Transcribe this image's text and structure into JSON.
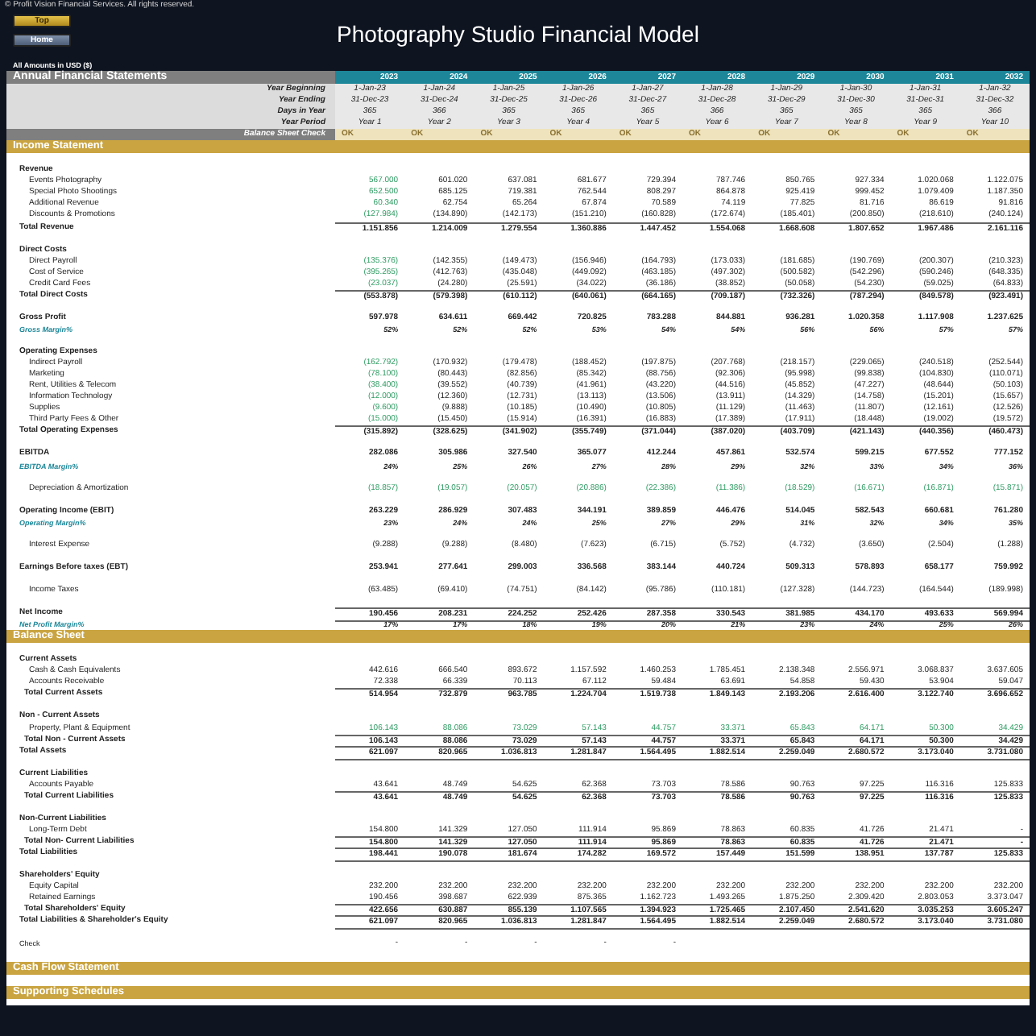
{
  "copyright": "© Profit Vision Financial Services. All rights reserved.",
  "buttons": [
    {
      "label": "Top",
      "kind": "gold"
    },
    {
      "label": "Home",
      "kind": "slate"
    }
  ],
  "title": "Photography Studio Financial Model",
  "units_note": "All Amounts in  USD ($)",
  "header": {
    "title": "Annual Financial Statements",
    "years": [
      "2023",
      "2024",
      "2025",
      "2026",
      "2027",
      "2028",
      "2029",
      "2030",
      "2031",
      "2032"
    ],
    "rows": [
      {
        "label": "Year Beginning",
        "values": [
          "1-Jan-23",
          "1-Jan-24",
          "1-Jan-25",
          "1-Jan-26",
          "1-Jan-27",
          "1-Jan-28",
          "1-Jan-29",
          "1-Jan-30",
          "1-Jan-31",
          "1-Jan-32"
        ]
      },
      {
        "label": "Year Ending",
        "values": [
          "31-Dec-23",
          "31-Dec-24",
          "31-Dec-25",
          "31-Dec-26",
          "31-Dec-27",
          "31-Dec-28",
          "31-Dec-29",
          "31-Dec-30",
          "31-Dec-31",
          "31-Dec-32"
        ]
      },
      {
        "label": "Days in Year",
        "values": [
          "365",
          "366",
          "365",
          "365",
          "365",
          "366",
          "365",
          "365",
          "365",
          "366"
        ]
      },
      {
        "label": "Year Period",
        "values": [
          "Year 1",
          "Year 2",
          "Year 3",
          "Year 4",
          "Year 5",
          "Year 6",
          "Year 7",
          "Year 8",
          "Year 9",
          "Year 10"
        ]
      }
    ],
    "check": {
      "label": "Balance Sheet Check",
      "values": [
        "OK",
        "OK",
        "OK",
        "OK",
        "OK",
        "OK",
        "OK",
        "OK",
        "OK",
        "OK"
      ]
    }
  },
  "sections": [
    {
      "title": "Income Statement",
      "rows": [
        {
          "label": "Revenue",
          "kind": "heading",
          "space_before": true,
          "values": []
        },
        {
          "label": "Events Photography",
          "kind": "item",
          "first_input": true,
          "values": [
            "567.000",
            "601.020",
            "637.081",
            "681.677",
            "729.394",
            "787.746",
            "850.765",
            "927.334",
            "1.020.068",
            "1.122.075"
          ]
        },
        {
          "label": "Special Photo Shootings",
          "kind": "item",
          "first_input": true,
          "values": [
            "652.500",
            "685.125",
            "719.381",
            "762.544",
            "808.297",
            "864.878",
            "925.419",
            "999.452",
            "1.079.409",
            "1.187.350"
          ]
        },
        {
          "label": "Additional Revenue",
          "kind": "item",
          "first_input": true,
          "values": [
            "60.340",
            "62.754",
            "65.264",
            "67.874",
            "70.589",
            "74.119",
            "77.825",
            "81.716",
            "86.619",
            "91.816"
          ]
        },
        {
          "label": "Discounts & Promotions",
          "kind": "item",
          "first_input": true,
          "values": [
            "(127.984)",
            "(134.890)",
            "(142.173)",
            "(151.210)",
            "(160.828)",
            "(172.674)",
            "(185.401)",
            "(200.850)",
            "(218.610)",
            "(240.124)"
          ]
        },
        {
          "label": "Total Revenue",
          "kind": "total",
          "values": [
            "1.151.856",
            "1.214.009",
            "1.279.554",
            "1.360.886",
            "1.447.452",
            "1.554.068",
            "1.668.608",
            "1.807.652",
            "1.967.486",
            "2.161.116"
          ]
        },
        {
          "label": "Direct Costs",
          "kind": "heading",
          "space_before": true,
          "values": []
        },
        {
          "label": "Direct Payroll",
          "kind": "item",
          "first_input": true,
          "values": [
            "(135.376)",
            "(142.355)",
            "(149.473)",
            "(156.946)",
            "(164.793)",
            "(173.033)",
            "(181.685)",
            "(190.769)",
            "(200.307)",
            "(210.323)"
          ]
        },
        {
          "label": "Cost of Service",
          "kind": "item",
          "first_input": true,
          "values": [
            "(395.265)",
            "(412.763)",
            "(435.048)",
            "(449.092)",
            "(463.185)",
            "(497.302)",
            "(500.582)",
            "(542.296)",
            "(590.246)",
            "(648.335)"
          ]
        },
        {
          "label": "Credit Card Fees",
          "kind": "item",
          "first_input": true,
          "values": [
            "(23.037)",
            "(24.280)",
            "(25.591)",
            "(34.022)",
            "(36.186)",
            "(38.852)",
            "(50.058)",
            "(54.230)",
            "(59.025)",
            "(64.833)"
          ]
        },
        {
          "label": "Total Direct Costs",
          "kind": "total",
          "values": [
            "(553.878)",
            "(579.398)",
            "(610.112)",
            "(640.061)",
            "(664.165)",
            "(709.187)",
            "(732.326)",
            "(787.294)",
            "(849.578)",
            "(923.491)"
          ]
        },
        {
          "label": "Gross Profit",
          "kind": "key",
          "space_before": true,
          "values": [
            "597.978",
            "634.611",
            "669.442",
            "720.825",
            "783.288",
            "844.881",
            "936.281",
            "1.020.358",
            "1.117.908",
            "1.237.625"
          ]
        },
        {
          "label": "Gross Margin%",
          "kind": "margin",
          "values": [
            "52%",
            "52%",
            "52%",
            "53%",
            "54%",
            "54%",
            "56%",
            "56%",
            "57%",
            "57%"
          ]
        },
        {
          "label": "Operating Expenses",
          "kind": "heading",
          "space_before": true,
          "values": []
        },
        {
          "label": "Indirect Payroll",
          "kind": "item",
          "first_input": true,
          "values": [
            "(162.792)",
            "(170.932)",
            "(179.478)",
            "(188.452)",
            "(197.875)",
            "(207.768)",
            "(218.157)",
            "(229.065)",
            "(240.518)",
            "(252.544)"
          ]
        },
        {
          "label": "Marketing",
          "kind": "item",
          "first_input": true,
          "values": [
            "(78.100)",
            "(80.443)",
            "(82.856)",
            "(85.342)",
            "(88.756)",
            "(92.306)",
            "(95.998)",
            "(99.838)",
            "(104.830)",
            "(110.071)"
          ]
        },
        {
          "label": "Rent, Utilities & Telecom",
          "kind": "item",
          "first_input": true,
          "values": [
            "(38.400)",
            "(39.552)",
            "(40.739)",
            "(41.961)",
            "(43.220)",
            "(44.516)",
            "(45.852)",
            "(47.227)",
            "(48.644)",
            "(50.103)"
          ]
        },
        {
          "label": "Information Technology",
          "kind": "item",
          "first_input": true,
          "values": [
            "(12.000)",
            "(12.360)",
            "(12.731)",
            "(13.113)",
            "(13.506)",
            "(13.911)",
            "(14.329)",
            "(14.758)",
            "(15.201)",
            "(15.657)"
          ]
        },
        {
          "label": "Supplies",
          "kind": "item",
          "first_input": true,
          "values": [
            "(9.600)",
            "(9.888)",
            "(10.185)",
            "(10.490)",
            "(10.805)",
            "(11.129)",
            "(11.463)",
            "(11.807)",
            "(12.161)",
            "(12.526)"
          ]
        },
        {
          "label": "Third Party Fees & Other",
          "kind": "item",
          "first_input": true,
          "values": [
            "(15.000)",
            "(15.450)",
            "(15.914)",
            "(16.391)",
            "(16.883)",
            "(17.389)",
            "(17.911)",
            "(18.448)",
            "(19.002)",
            "(19.572)"
          ]
        },
        {
          "label": "Total Operating Expenses",
          "kind": "total",
          "values": [
            "(315.892)",
            "(328.625)",
            "(341.902)",
            "(355.749)",
            "(371.044)",
            "(387.020)",
            "(403.709)",
            "(421.143)",
            "(440.356)",
            "(460.473)"
          ]
        },
        {
          "label": "EBITDA",
          "kind": "key",
          "space_before": true,
          "values": [
            "282.086",
            "305.986",
            "327.540",
            "365.077",
            "412.244",
            "457.861",
            "532.574",
            "599.215",
            "677.552",
            "777.152"
          ]
        },
        {
          "label": "EBITDA Margin%",
          "kind": "margin",
          "values": [
            "24%",
            "25%",
            "26%",
            "27%",
            "28%",
            "29%",
            "32%",
            "33%",
            "34%",
            "36%"
          ]
        },
        {
          "label": "Depreciation & Amortization",
          "kind": "item",
          "all_input": true,
          "space_before": true,
          "values": [
            "(18.857)",
            "(19.057)",
            "(20.057)",
            "(20.886)",
            "(22.386)",
            "(11.386)",
            "(18.529)",
            "(16.671)",
            "(16.871)",
            "(15.871)"
          ]
        },
        {
          "label": "Operating Income (EBIT)",
          "kind": "key",
          "space_before": true,
          "values": [
            "263.229",
            "286.929",
            "307.483",
            "344.191",
            "389.859",
            "446.476",
            "514.045",
            "582.543",
            "660.681",
            "761.280"
          ]
        },
        {
          "label": "Operating Margin%",
          "kind": "margin",
          "values": [
            "23%",
            "24%",
            "24%",
            "25%",
            "27%",
            "29%",
            "31%",
            "32%",
            "34%",
            "35%"
          ]
        },
        {
          "label": "Interest Expense",
          "kind": "item",
          "space_before": true,
          "values": [
            "(9.288)",
            "(9.288)",
            "(8.480)",
            "(7.623)",
            "(6.715)",
            "(5.752)",
            "(4.732)",
            "(3.650)",
            "(2.504)",
            "(1.288)"
          ]
        },
        {
          "label": "Earnings Before taxes (EBT)",
          "kind": "key",
          "space_before": true,
          "values": [
            "253.941",
            "277.641",
            "299.003",
            "336.568",
            "383.144",
            "440.724",
            "509.313",
            "578.893",
            "658.177",
            "759.992"
          ]
        },
        {
          "label": "Income Taxes",
          "kind": "item",
          "space_before": true,
          "values": [
            "(63.485)",
            "(69.410)",
            "(74.751)",
            "(84.142)",
            "(95.786)",
            "(110.181)",
            "(127.328)",
            "(144.723)",
            "(164.544)",
            "(189.998)"
          ]
        },
        {
          "label": "Net Income",
          "kind": "grand_total",
          "space_before": true,
          "values": [
            "190.456",
            "208.231",
            "224.252",
            "252.426",
            "287.358",
            "330.543",
            "381.985",
            "434.170",
            "493.633",
            "569.994"
          ]
        },
        {
          "label": "Net Profit Margin%",
          "kind": "margin",
          "values": [
            "17%",
            "17%",
            "18%",
            "19%",
            "20%",
            "21%",
            "23%",
            "24%",
            "25%",
            "26%"
          ]
        }
      ]
    },
    {
      "title": "Balance Sheet",
      "rows": [
        {
          "label": "Current Assets",
          "kind": "heading",
          "space_before": true,
          "values": []
        },
        {
          "label": "Cash & Cash Equivalents",
          "kind": "item",
          "values": [
            "442.616",
            "666.540",
            "893.672",
            "1.157.592",
            "1.460.253",
            "1.785.451",
            "2.138.348",
            "2.556.971",
            "3.068.837",
            "3.637.605"
          ]
        },
        {
          "label": "Accounts Receivable",
          "kind": "item",
          "values": [
            "72.338",
            "66.339",
            "70.113",
            "67.112",
            "59.484",
            "63.691",
            "54.858",
            "59.430",
            "53.904",
            "59.047"
          ]
        },
        {
          "label": "Total Current Assets",
          "kind": "subtotal",
          "values": [
            "514.954",
            "732.879",
            "963.785",
            "1.224.704",
            "1.519.738",
            "1.849.143",
            "2.193.206",
            "2.616.400",
            "3.122.740",
            "3.696.652"
          ]
        },
        {
          "label": "Non - Current Assets",
          "kind": "heading",
          "space_before": true,
          "values": []
        },
        {
          "label": "Property, Plant & Equipment",
          "kind": "item",
          "all_input": true,
          "values": [
            "106.143",
            "88.086",
            "73.029",
            "57.143",
            "44.757",
            "33.371",
            "65.843",
            "64.171",
            "50.300",
            "34.429"
          ]
        },
        {
          "label": "Total Non - Current Assets",
          "kind": "subtotal",
          "values": [
            "106.143",
            "88.086",
            "73.029",
            "57.143",
            "44.757",
            "33.371",
            "65.843",
            "64.171",
            "50.300",
            "34.429"
          ]
        },
        {
          "label": "Total Assets",
          "kind": "grand_total",
          "values": [
            "621.097",
            "820.965",
            "1.036.813",
            "1.281.847",
            "1.564.495",
            "1.882.514",
            "2.259.049",
            "2.680.572",
            "3.173.040",
            "3.731.080"
          ]
        },
        {
          "label": "Current Liabilities",
          "kind": "heading",
          "space_before": true,
          "values": []
        },
        {
          "label": "Accounts Payable",
          "kind": "item",
          "values": [
            "43.641",
            "48.749",
            "54.625",
            "62.368",
            "73.703",
            "78.586",
            "90.763",
            "97.225",
            "116.316",
            "125.833"
          ]
        },
        {
          "label": "Total Current Liabilities",
          "kind": "subtotal",
          "values": [
            "43.641",
            "48.749",
            "54.625",
            "62.368",
            "73.703",
            "78.586",
            "90.763",
            "97.225",
            "116.316",
            "125.833"
          ]
        },
        {
          "label": "Non-Current Liabilities",
          "kind": "heading",
          "space_before": true,
          "values": []
        },
        {
          "label": "Long-Term Debt",
          "kind": "item",
          "values": [
            "154.800",
            "141.329",
            "127.050",
            "111.914",
            "95.869",
            "78.863",
            "60.835",
            "41.726",
            "21.471",
            "-"
          ]
        },
        {
          "label": "Total Non- Current Liabilities",
          "kind": "subtotal",
          "values": [
            "154.800",
            "141.329",
            "127.050",
            "111.914",
            "95.869",
            "78.863",
            "60.835",
            "41.726",
            "21.471",
            "-"
          ]
        },
        {
          "label": "Total Liabilities",
          "kind": "grand_total",
          "values": [
            "198.441",
            "190.078",
            "181.674",
            "174.282",
            "169.572",
            "157.449",
            "151.599",
            "138.951",
            "137.787",
            "125.833"
          ]
        },
        {
          "label": "Shareholders' Equity",
          "kind": "heading",
          "space_before": true,
          "values": []
        },
        {
          "label": "Equity Capital",
          "kind": "item",
          "values": [
            "232.200",
            "232.200",
            "232.200",
            "232.200",
            "232.200",
            "232.200",
            "232.200",
            "232.200",
            "232.200",
            "232.200"
          ]
        },
        {
          "label": "Retained Earnings",
          "kind": "item",
          "values": [
            "190.456",
            "398.687",
            "622.939",
            "875.365",
            "1.162.723",
            "1.493.265",
            "1.875.250",
            "2.309.420",
            "2.803.053",
            "3.373.047"
          ]
        },
        {
          "label": "Total Shareholders' Equity",
          "kind": "subtotal",
          "values": [
            "422.656",
            "630.887",
            "855.139",
            "1.107.565",
            "1.394.923",
            "1.725.465",
            "2.107.450",
            "2.541.620",
            "3.035.253",
            "3.605.247"
          ]
        },
        {
          "label": "Total Liabilities & Shareholder's Equity",
          "kind": "grand_total",
          "values": [
            "621.097",
            "820.965",
            "1.036.813",
            "1.281.847",
            "1.564.495",
            "1.882.514",
            "2.259.049",
            "2.680.572",
            "3.173.040",
            "3.731.080"
          ]
        },
        {
          "label": "Check",
          "kind": "note",
          "space_before": true,
          "values": [
            "-",
            "-",
            "-",
            "-",
            "-"
          ]
        }
      ]
    },
    {
      "title": "Cash Flow Statement"
    },
    {
      "title": "Supporting Schedules"
    }
  ]
}
